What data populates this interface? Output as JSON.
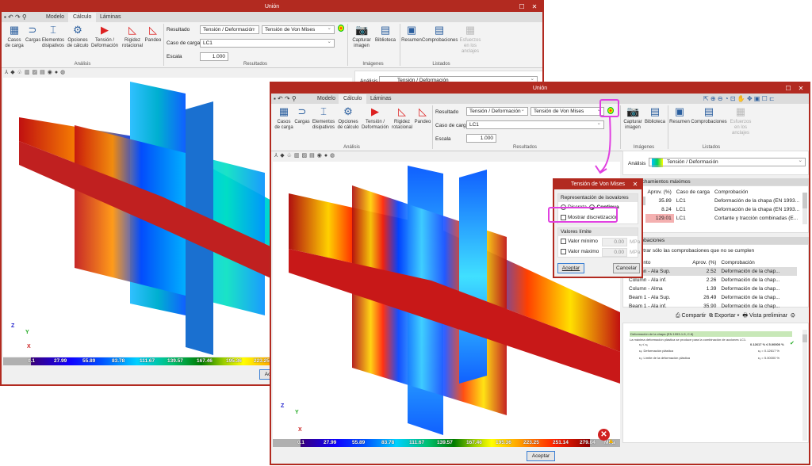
{
  "app": {
    "title": "Unión",
    "tabs": [
      "Modelo",
      "Cálculo",
      "Láminas"
    ],
    "active_tab": "Cálculo"
  },
  "ribbon": {
    "analysis_buttons": [
      "Casos de carga",
      "Cargas",
      "Elementos disipativos",
      "Opciones de cálculo",
      "Tensión / Deformación",
      "Rigidez rotacional",
      "Pandeo"
    ],
    "analysis_group": "Análisis",
    "resultado_label": "Resultado",
    "resultado_value": "Tensión / Deformación",
    "resultado_sub_value": "Tensión de Von Mises",
    "caso_label": "Caso de carga",
    "caso_value": "LC1",
    "escala_label": "Escala",
    "escala_value": "1.000",
    "results_group": "Resultados",
    "image_buttons": [
      "Capturar imagen",
      "Biblioteca"
    ],
    "images_group": "Imágenes",
    "list_buttons": [
      "Resumen",
      "Comprobaciones",
      "Esfuerzos en los anclajes"
    ],
    "lists_group": "Listados"
  },
  "colorbar": {
    "values": [
      "0.1",
      "27.99",
      "55.89",
      "83.78",
      "111.67",
      "139.57",
      "167.46",
      "195.36",
      "223.25",
      "251.14",
      "279.04"
    ],
    "unit": "MPa"
  },
  "footer": {
    "accept": "Aceptar"
  },
  "right_panel": {
    "analysis_label": "Análisis",
    "analysis_value": "Tensión / Deformación",
    "max_title": "Aprovechamientos máximos",
    "max_headers": [
      "Aprov. (%)",
      "Caso de carga",
      "Comprobación"
    ],
    "max_rows": [
      {
        "aprov": "35.89",
        "caso": "LC1",
        "comp": "Deformación de la chapa (EN 1993..."
      },
      {
        "aprov": "8.24",
        "caso": "LC1",
        "comp": "Deformación de la chapa (EN 1993..."
      },
      {
        "aprov": "129.01",
        "caso": "LC1",
        "comp": "Cortante y tracción combinadas (E..."
      }
    ],
    "checks_title": "Comprobaciones",
    "only_failing": "Mostrar sólo las comprobaciones que no se cumplen",
    "checks_headers": [
      "Elemento",
      "Aprov. (%)",
      "Comprobación"
    ],
    "checks_rows": [
      {
        "el": "Column - Ala Sup.",
        "aprov": "2.52",
        "comp": "Deformación de la chap..."
      },
      {
        "el": "Column - Ala inf.",
        "aprov": "2.26",
        "comp": "Deformación de la chap..."
      },
      {
        "el": "Column - Alma",
        "aprov": "1.39",
        "comp": "Deformación de la chap..."
      },
      {
        "el": "Beam 1 - Ala Sup.",
        "aprov": "26.49",
        "comp": "Deformación de la chap..."
      },
      {
        "el": "Beam 1 - Ala inf.",
        "aprov": "35.90",
        "comp": "Deformación de la chap..."
      }
    ],
    "share": "Compartir",
    "export": "Exportar",
    "preview": "Vista preliminar",
    "report": {
      "heading": "Deformación de la chapa (EN 1993-1-5, C.8)",
      "line1": "La máxima deformación plástica se produce para la combinación de acciones LC1.",
      "cond": "εₑ ≤ εᵤ",
      "cond_values": "0.12617 % ≤ 5.00000 %",
      "e_label": "εₑ: Deformación plástica",
      "e_value": "εₑ = 0.12617 %",
      "u_label": "εᵤ: Límite de la deformación plástica",
      "u_value": "εᵤ = 5.00000 %"
    }
  },
  "dialog": {
    "title": "Tensión de Von Mises",
    "iso_group": "Representación de isovalores",
    "discreta": "Discreta",
    "continua": "Continua",
    "selected": "Continua",
    "show_disc": "Mostrar discretización",
    "limits_group": "Valores límite",
    "min_label": "Valor mínimo",
    "min_value": "0.00",
    "max_label": "Valor máximo",
    "max_value": "0.00",
    "unit": "MPa",
    "ok": "Aceptar",
    "cancel": "Cancelar"
  },
  "axes": {
    "x": "X",
    "y": "Y",
    "z": "Z"
  }
}
